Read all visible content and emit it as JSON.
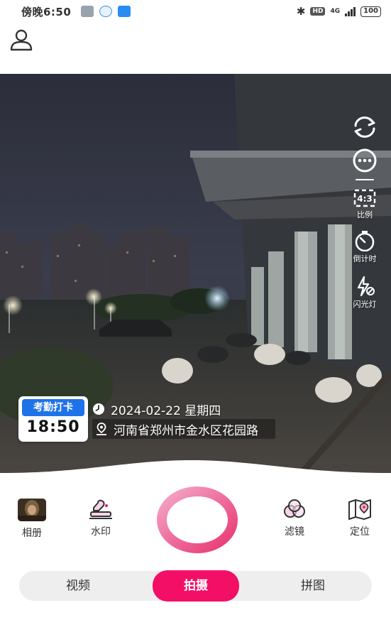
{
  "status_bar": {
    "time": "傍晚6:50",
    "network": "4G",
    "hd": "HD",
    "battery": "100"
  },
  "top_bar": {
    "profile_icon": "user-icon"
  },
  "side_tools": {
    "switch_camera_icon": "switch-camera-icon",
    "more_icon": "more-icon",
    "ratio_label": "比例",
    "ratio_value": "4:3",
    "timer_label": "倒计时",
    "flash_label": "闪光灯"
  },
  "watermark": {
    "title": "考勤打卡",
    "time": "18:50",
    "date": "2024-02-22 星期四",
    "location": "河南省郑州市金水区花园路"
  },
  "controls": {
    "album_label": "相册",
    "watermark_label": "水印",
    "filter_label": "滤镜",
    "location_label": "定位"
  },
  "modes": {
    "items": [
      "视频",
      "拍摄",
      "拼图"
    ],
    "active": "拍摄"
  },
  "colors": {
    "accent": "#f20f65",
    "watermark_blue": "#1f73e8"
  }
}
